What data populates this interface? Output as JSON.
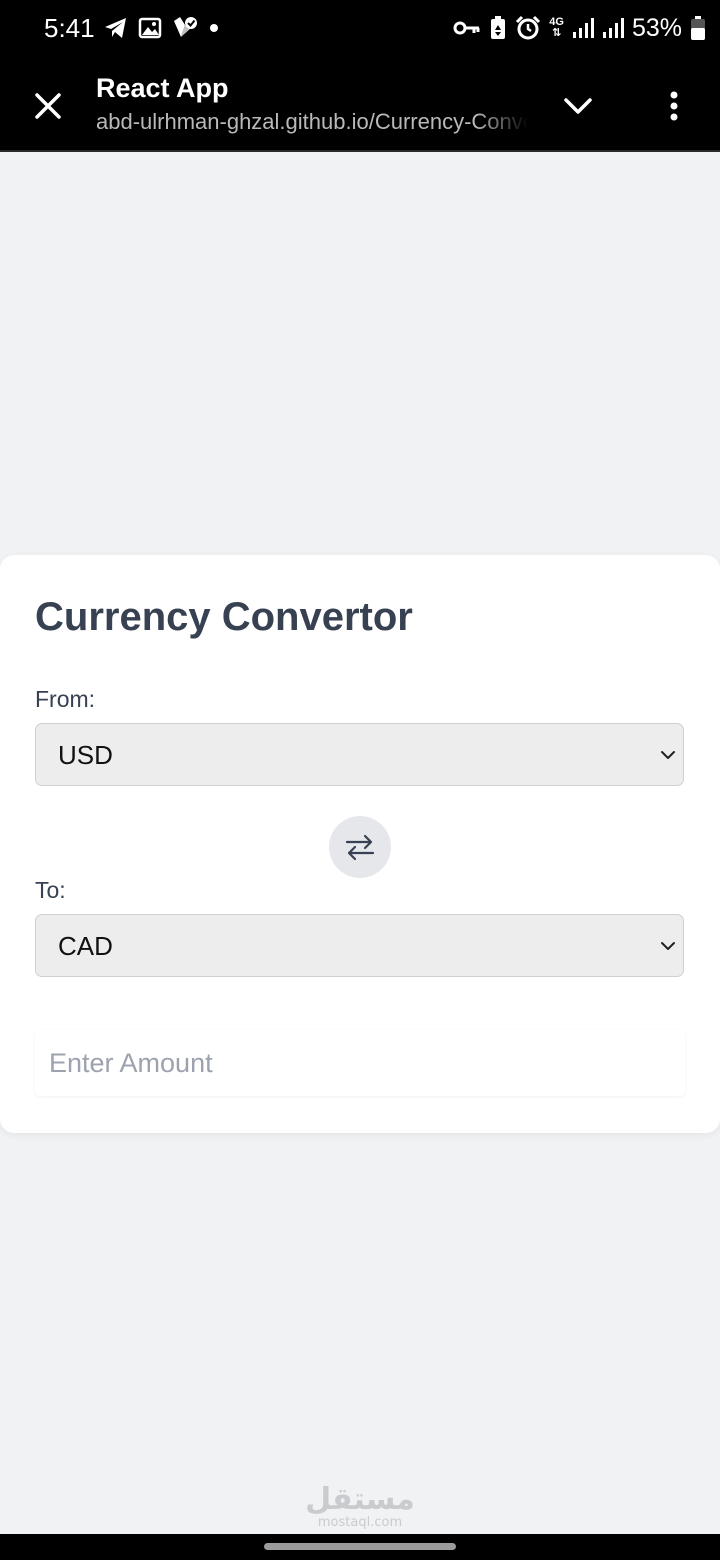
{
  "status_bar": {
    "time": "5:41",
    "battery_percent": "53%",
    "network": "4G",
    "left_icons": [
      "telegram-icon",
      "image-icon",
      "shield-check-icon",
      "dot-icon"
    ],
    "right_icons": [
      "key-icon",
      "battery-saver-icon",
      "alarm-icon",
      "network-4g-icon",
      "signal-icon",
      "signal-icon",
      "battery-icon"
    ]
  },
  "browser": {
    "title": "React App",
    "url": "abd-ulrhman-ghzal.github.io/Currency-Convertor/",
    "icons": [
      "close-icon",
      "chevron-down-icon",
      "more-vert-icon"
    ]
  },
  "app": {
    "title": "Currency Convertor",
    "from_label": "From:",
    "from_value": "USD",
    "to_label": "To:",
    "to_value": "CAD",
    "amount_placeholder": "Enter Amount",
    "amount_value": "",
    "swap_icon": "swap-arrows-icon"
  },
  "watermark": {
    "arabic": "مستقل",
    "latin": "mostaql.com"
  },
  "colors": {
    "background": "#f1f2f4",
    "card": "#ffffff",
    "title_text": "#374151",
    "select_bg": "#ededed",
    "swap_bg": "#e5e7eb",
    "placeholder": "#9ca3af"
  }
}
